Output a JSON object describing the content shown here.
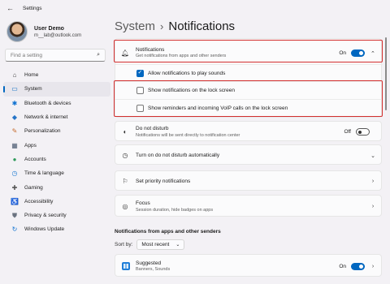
{
  "window": {
    "title": "Settings",
    "back_icon": "back-arrow-icon"
  },
  "profile": {
    "name": "User Demo",
    "email": "m__lab@outlook.com"
  },
  "search": {
    "placeholder": "Find a setting",
    "icon": "search-icon"
  },
  "sidebar": {
    "items": [
      {
        "label": "Home",
        "icon": "home-icon",
        "glyph": "⌂",
        "active": false
      },
      {
        "label": "System",
        "icon": "system-icon",
        "glyph": "▭",
        "active": true
      },
      {
        "label": "Bluetooth & devices",
        "icon": "bluetooth-icon",
        "glyph": "✱",
        "active": false
      },
      {
        "label": "Network & internet",
        "icon": "wifi-icon",
        "glyph": "◆",
        "active": false
      },
      {
        "label": "Personalization",
        "icon": "brush-icon",
        "glyph": "✎",
        "active": false
      },
      {
        "label": "Apps",
        "icon": "apps-icon",
        "glyph": "▦",
        "active": false
      },
      {
        "label": "Accounts",
        "icon": "person-icon",
        "glyph": "●",
        "active": false
      },
      {
        "label": "Time & language",
        "icon": "globe-clock-icon",
        "glyph": "◷",
        "active": false
      },
      {
        "label": "Gaming",
        "icon": "gamepad-icon",
        "glyph": "✚",
        "active": false
      },
      {
        "label": "Accessibility",
        "icon": "accessibility-icon",
        "glyph": "♿",
        "active": false
      },
      {
        "label": "Privacy & security",
        "icon": "shield-icon",
        "glyph": "⛊",
        "active": false
      },
      {
        "label": "Windows Update",
        "icon": "update-icon",
        "glyph": "↻",
        "active": false
      }
    ]
  },
  "breadcrumb": {
    "parent": "System",
    "separator": "›",
    "current": "Notifications"
  },
  "notifications": {
    "title": "Notifications",
    "subtitle": "Get notifications from apps and other senders",
    "state": "On",
    "options": [
      {
        "label": "Allow notifications to play sounds",
        "checked": true
      },
      {
        "label": "Show notifications on the lock screen",
        "checked": false
      },
      {
        "label": "Show reminders and incoming VoIP calls on the lock screen",
        "checked": false
      }
    ]
  },
  "dnd": {
    "title": "Do not disturb",
    "subtitle": "Notifications will be sent directly to notification center",
    "state": "Off"
  },
  "auto_dnd": {
    "title": "Turn on do not disturb automatically"
  },
  "priority": {
    "title": "Set priority notifications"
  },
  "focus": {
    "title": "Focus",
    "subtitle": "Session duration, hide badges on apps"
  },
  "apps_section": {
    "title": "Notifications from apps and other senders",
    "sort_label": "Sort by:",
    "sort_value": "Most recent",
    "apps": [
      {
        "name": "Suggested",
        "detail": "Banners, Sounds",
        "state": "On"
      }
    ]
  },
  "colors": {
    "accent": "#0067c0",
    "highlight": "#d32f2f"
  }
}
